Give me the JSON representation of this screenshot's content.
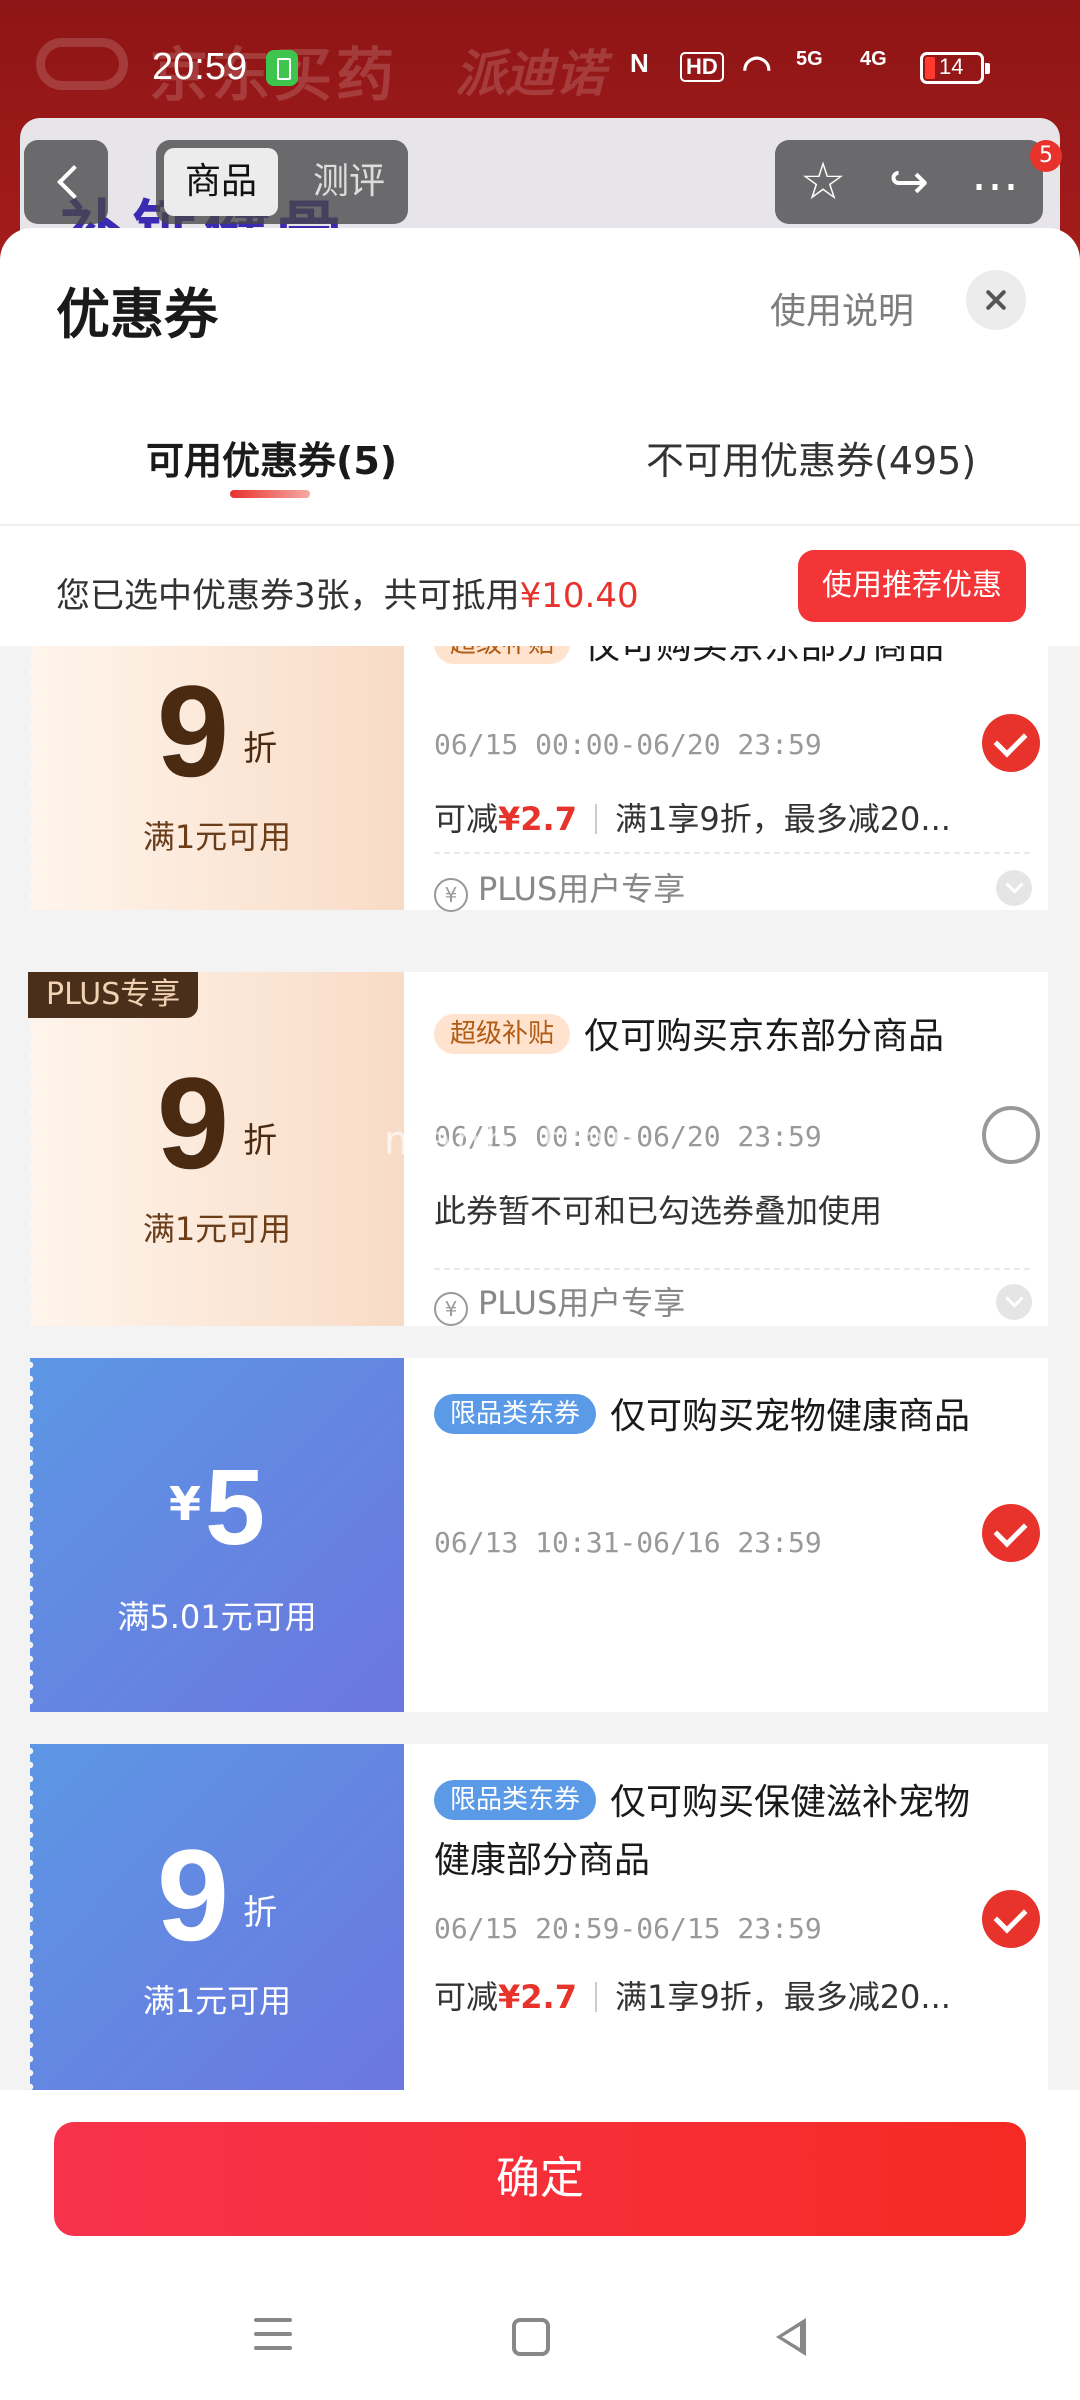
{
  "status_bar": {
    "time": "20:59",
    "battery": "14",
    "network_5g": "5G",
    "network_4g": "4G",
    "hd_badge": "HD"
  },
  "background": {
    "brand": "京东买药",
    "brand2": "派迪诺",
    "banner_text": "补钙健骨",
    "tabs": {
      "active": "商品",
      "inactive": "测评"
    },
    "badge_count": "5"
  },
  "sheet": {
    "title": "优惠券",
    "help_link": "使用说明",
    "tabs": [
      {
        "label": "可用优惠券(5)",
        "active": true
      },
      {
        "label": "不可用优惠券(495)",
        "active": false
      }
    ],
    "summary": {
      "prefix": "您已选中优惠券3张，共可抵用",
      "amount": "¥10.40"
    },
    "recommend_button": "使用推荐优惠"
  },
  "coupons": [
    {
      "style": "plus",
      "value": "9",
      "unit": "折",
      "condition": "满1元可用",
      "tag": "超级补贴",
      "title": "仅可购买京东部分商品",
      "date": "06/15 00:00-06/20 23:59",
      "desc_prefix": "可减",
      "desc_amount": "¥2.7",
      "desc_rule": "满1享9折，最多减20...",
      "plus_line": "PLUS用户专享",
      "checked": true
    },
    {
      "style": "plus",
      "corner_tag": "PLUS专享",
      "value": "9",
      "unit": "折",
      "condition": "满1元可用",
      "tag": "超级补贴",
      "title": "仅可购买京东部分商品",
      "date": "06/15 00:00-06/20 23:59",
      "desc": "此券暂不可和已勾选券叠加使用",
      "plus_line": "PLUS用户专享",
      "checked": false
    },
    {
      "style": "blue",
      "currency": "¥",
      "value": "5",
      "condition": "满5.01元可用",
      "tag": "限品类东券",
      "title": "仅可购买宠物健康商品",
      "date": "06/13 10:31-06/16 23:59",
      "checked": true
    },
    {
      "style": "blue",
      "value": "9",
      "unit": "折",
      "condition": "满1元可用",
      "tag": "限品类东券",
      "title": "仅可购买保健滋补宠物健康部分商品",
      "date": "06/15 20:59-06/15 23:59",
      "desc_prefix": "可减",
      "desc_amount": "¥2.7",
      "desc_rule": "满1享9折，最多减20...",
      "checked": true
    }
  ],
  "watermark": "manhattan",
  "confirm_button": "确定",
  "icons": {
    "back": "back-chevron-icon",
    "star": "star-icon",
    "share": "share-icon",
    "more": "more-icon",
    "close": "close-icon",
    "check": "checkmark-icon",
    "plus": "yuan-circle-icon"
  },
  "colors": {
    "accent": "#e8332d",
    "plus_bg": "#f8dbc6",
    "blue_bg": "#6c76df"
  }
}
